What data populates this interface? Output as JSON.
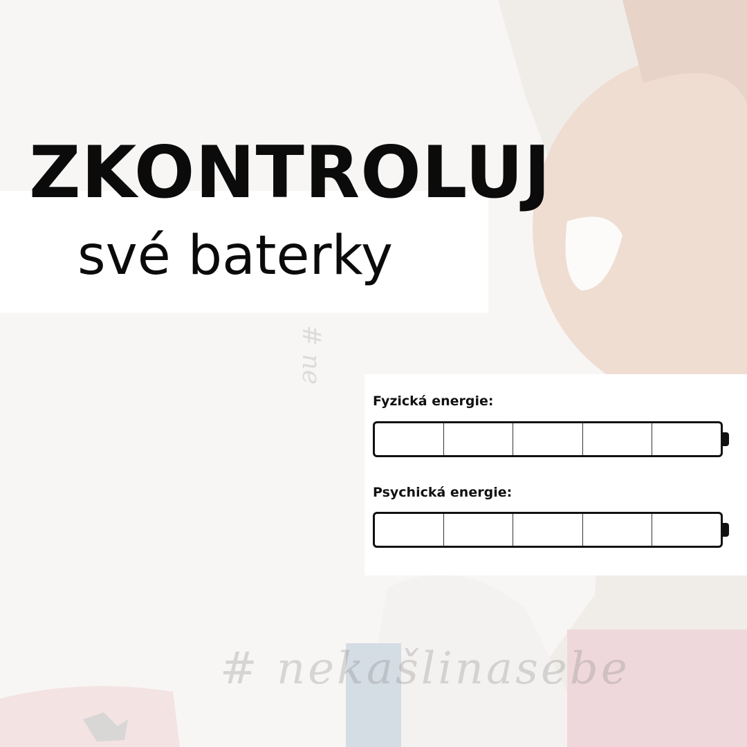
{
  "headline": {
    "title": "ZKONTROLUJ",
    "subtitle": "své baterky"
  },
  "energy_card": {
    "batteries": [
      {
        "label": "Fyzická energie:",
        "segments": 5,
        "filled": 0
      },
      {
        "label": "Psychická energie:",
        "segments": 5,
        "filled": 0
      }
    ]
  },
  "watermark": {
    "hashtag": "# nekašlinasebe",
    "vertical": "# ne"
  },
  "colors": {
    "text": "#0b0b0b",
    "panel": "#ffffff",
    "battery_outline": "#111111"
  }
}
